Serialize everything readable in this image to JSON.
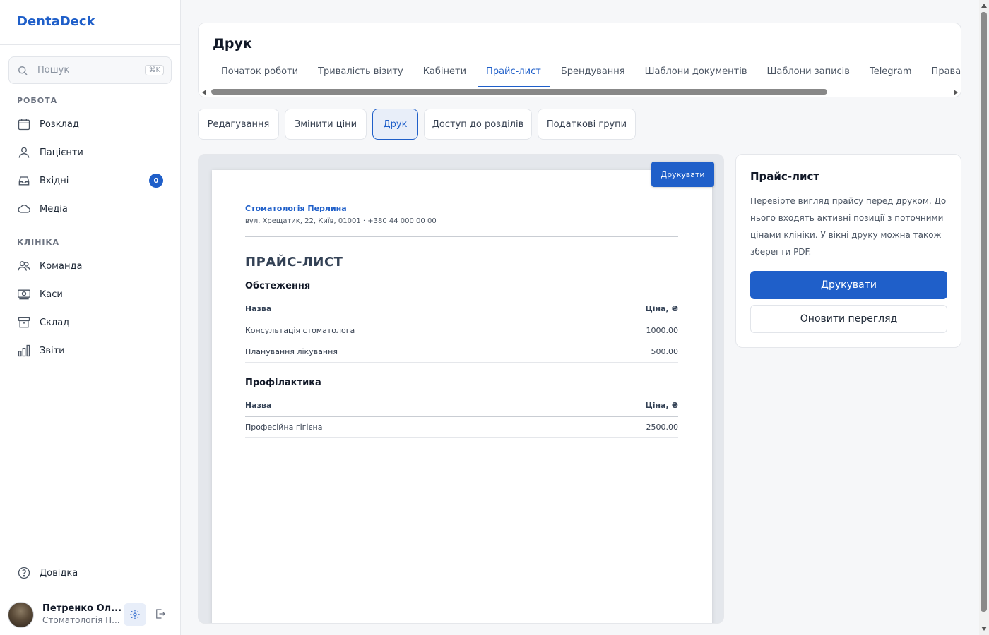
{
  "app": {
    "logo": "DentaDeck"
  },
  "search": {
    "placeholder": "Пошук",
    "shortcut": "⌘K"
  },
  "sidebar": {
    "sections": [
      {
        "label": "РОБОТА",
        "items": [
          {
            "label": "Розклад",
            "icon": "calendar-icon"
          },
          {
            "label": "Пацієнти",
            "icon": "patients-icon"
          },
          {
            "label": "Вхідні",
            "icon": "inbox-icon",
            "badge": "0"
          },
          {
            "label": "Медіа",
            "icon": "cloud-icon"
          }
        ]
      },
      {
        "label": "КЛІНІКА",
        "items": [
          {
            "label": "Команда",
            "icon": "team-icon"
          },
          {
            "label": "Каси",
            "icon": "cash-icon"
          },
          {
            "label": "Склад",
            "icon": "archive-icon"
          },
          {
            "label": "Звіти",
            "icon": "chart-icon"
          }
        ]
      }
    ],
    "help": "Довідка",
    "user": {
      "name": "Петренко Ол...",
      "clinic": "Стоматологія П..."
    }
  },
  "header": {
    "title": "Друк",
    "tabs": [
      "Початок роботи",
      "Тривалість візиту",
      "Кабінети",
      "Прайс-лист",
      "Брендування",
      "Шаблони документів",
      "Шаблони записів",
      "Telegram",
      "Права доступу"
    ],
    "active_tab": "Прайс-лист"
  },
  "subtabs": {
    "items": [
      "Редагування",
      "Змінити ціни",
      "Друк",
      "Доступ до розділів",
      "Податкові групи"
    ],
    "active": "Друк"
  },
  "preview": {
    "print_button": "Друкувати",
    "clinic_name": "Стоматологія Перлина",
    "clinic_address": "вул. Хрещатик, 22, Київ, 01001 · +380 44 000 00 00",
    "doc_title": "ПРАЙС-ЛИСТ",
    "groups": [
      {
        "title": "Обстеження",
        "col_name": "Назва",
        "col_price": "Ціна, ₴",
        "rows": [
          {
            "name": "Консультація стоматолога",
            "price": "1000.00"
          },
          {
            "name": "Планування лікування",
            "price": "500.00"
          }
        ]
      },
      {
        "title": "Профілактика",
        "col_name": "Назва",
        "col_price": "Ціна, ₴",
        "rows": [
          {
            "name": "Професійна гігієна",
            "price": "2500.00"
          }
        ]
      }
    ]
  },
  "info": {
    "title": "Прайс-лист",
    "text": "Перевірте вигляд прайсу перед друком. До нього входять активні позиції з поточними цінами клініки. У вікні друку можна також зберегти PDF.",
    "primary": "Друкувати",
    "secondary": "Оновити перегляд"
  },
  "colors": {
    "accent": "#1f5fc9",
    "background": "#f6f7f9"
  }
}
